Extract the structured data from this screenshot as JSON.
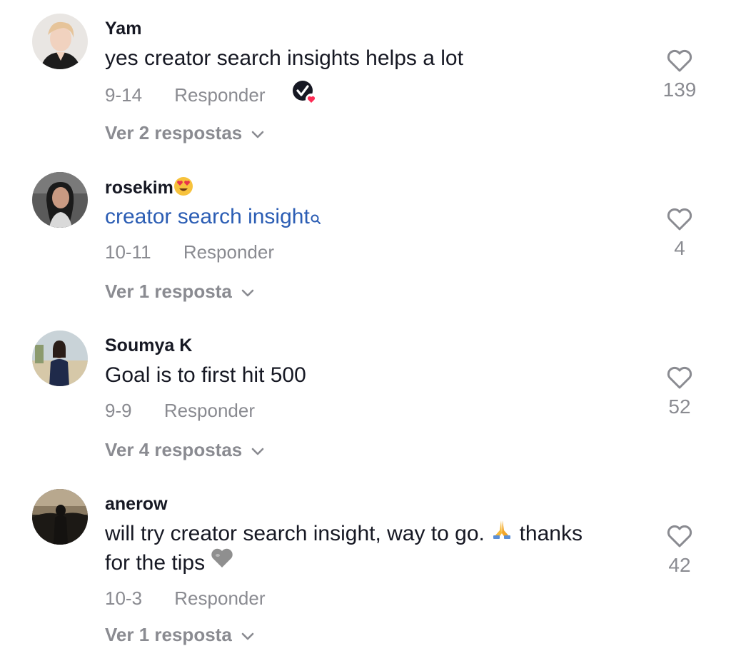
{
  "comments": [
    {
      "username": "Yam",
      "text": "yes creator search insights helps a lot",
      "date": "9-14",
      "reply_label": "Responder",
      "view_replies": "Ver 2 respostas",
      "likes": "139",
      "creator_liked": true,
      "avatar_icon": "avatar-photo"
    },
    {
      "username": "rosekim",
      "username_emoji": "heart-eyes-emoji",
      "text": "creator search insight",
      "text_is_link": true,
      "date": "10-11",
      "reply_label": "Responder",
      "view_replies": "Ver 1 resposta",
      "likes": "4",
      "avatar_icon": "avatar-photo"
    },
    {
      "username": "Soumya K",
      "text": "Goal is to first hit 500",
      "date": "9-9",
      "reply_label": "Responder",
      "view_replies": "Ver 4 respostas",
      "likes": "52",
      "avatar_icon": "avatar-photo"
    },
    {
      "username": "anerow",
      "text_part1": "will try creator search insight, way to go.",
      "text_part2": "thanks",
      "text_line2": "for the tips",
      "date": "10-3",
      "reply_label": "Responder",
      "view_replies": "Ver 1 resposta",
      "likes": "42",
      "avatar_icon": "avatar-photo"
    }
  ],
  "colors": {
    "text_primary": "#161823",
    "text_secondary": "#8a8b91",
    "link": "#2b5db4",
    "badge_heart": "#fe2c55"
  }
}
